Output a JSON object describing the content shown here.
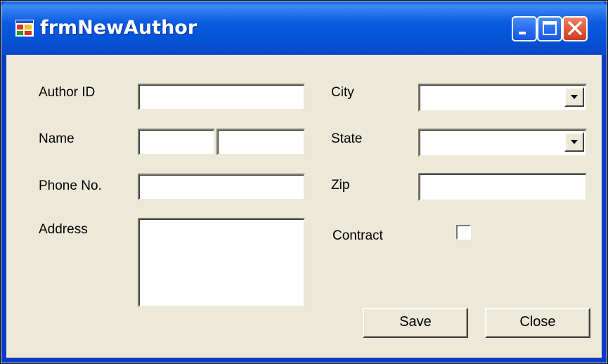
{
  "window": {
    "title": "frmNewAuthor",
    "icon": "form-app-icon"
  },
  "titlebar_buttons": {
    "minimize": "minimize-icon",
    "maximize": "maximize-icon",
    "close": "close-icon"
  },
  "form": {
    "labels": {
      "author_id": "Author ID",
      "name": "Name",
      "phone": "Phone No.",
      "address": "Address",
      "city": "City",
      "state": "State",
      "zip": "Zip",
      "contract": "Contract"
    },
    "values": {
      "author_id": "",
      "first_name": "",
      "last_name": "",
      "phone": "",
      "address": "",
      "city": "",
      "state": "",
      "zip": "",
      "contract": false
    }
  },
  "buttons": {
    "save": "Save",
    "close": "Close"
  },
  "colors": {
    "titlebar": "#0a5ce3",
    "form_background": "#ece9d8",
    "close_button": "#e45a3c"
  }
}
